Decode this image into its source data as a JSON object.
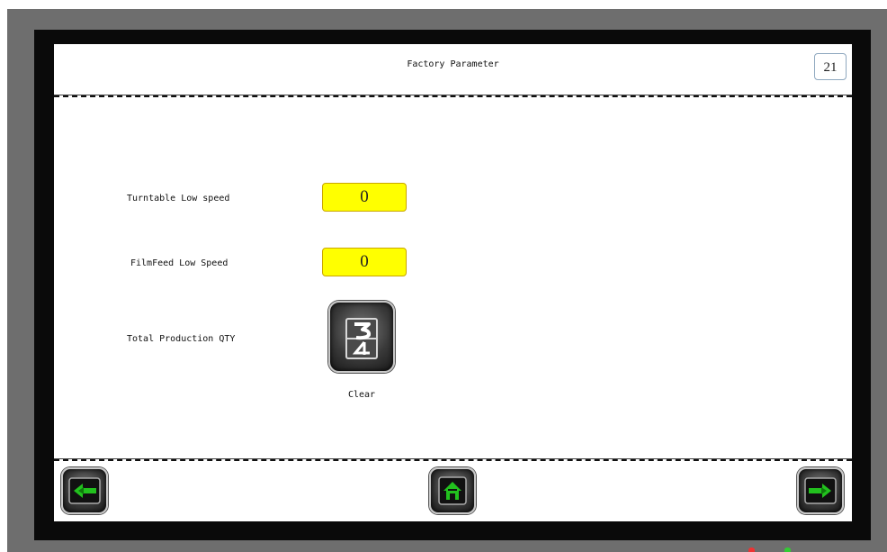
{
  "screen": {
    "title": "Factory Parameter",
    "page_number": "21"
  },
  "fields": [
    {
      "label": "Turntable Low speed",
      "value": "0"
    },
    {
      "label": "FilmFeed Low Speed",
      "value": "0"
    }
  ],
  "production": {
    "label": "Total Production QTY",
    "clear_label": "Clear",
    "clear_icon": "counter-reset-icon"
  },
  "navigation": {
    "prev_icon": "arrow-left-icon",
    "home_icon": "home-icon",
    "next_icon": "arrow-right-icon"
  },
  "colors": {
    "value_box": "#ffff00",
    "nav_arrow": "#22c11e",
    "bezel": "#0a0a0a"
  }
}
